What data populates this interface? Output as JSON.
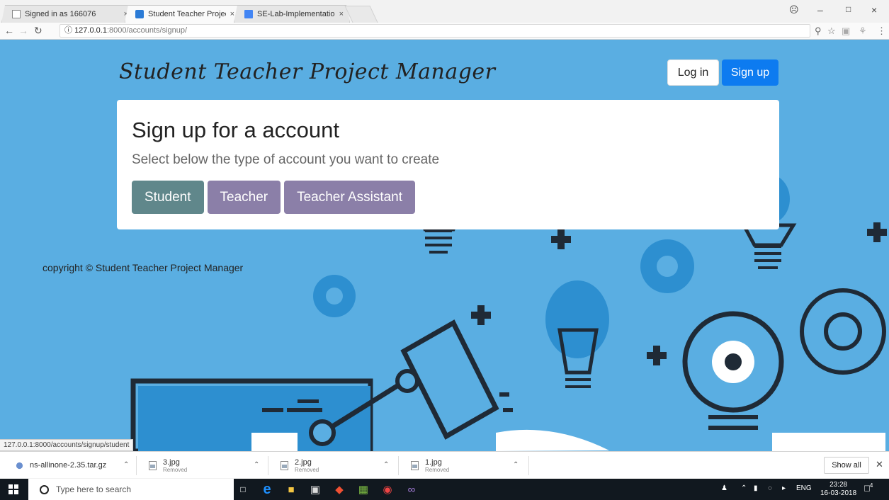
{
  "browser": {
    "tabs": [
      {
        "label": "Signed in as 166076",
        "close": "×"
      },
      {
        "label": "Student Teacher Project I",
        "close": "×"
      },
      {
        "label": "SE-Lab-Implementation-",
        "close": "×"
      }
    ],
    "address": {
      "host": "127.0.0.1",
      "path": ":8000/accounts/signup/"
    },
    "status_url": "127.0.0.1:8000/accounts/signup/student"
  },
  "page": {
    "brand": "Student Teacher Project Manager",
    "nav": {
      "login": "Log in",
      "signup": "Sign up"
    },
    "card": {
      "title": "Sign up for a account",
      "subtitle": "Select below the type of account you want to create",
      "choices": {
        "student": "Student",
        "teacher": "Teacher",
        "ta": "Teacher Assistant"
      }
    },
    "copyright": "copyright © Student Teacher Project Manager"
  },
  "downloads": {
    "items": [
      {
        "name": "ns-allinone-2.35.tar.gz",
        "sub": ""
      },
      {
        "name": "3.jpg",
        "sub": "Removed"
      },
      {
        "name": "2.jpg",
        "sub": "Removed"
      },
      {
        "name": "1.jpg",
        "sub": "Removed"
      }
    ],
    "show_all": "Show all"
  },
  "taskbar": {
    "search_placeholder": "Type here to search",
    "lang": "ENG",
    "time": "23:28",
    "date": "16-03-2018",
    "notifications": "4"
  },
  "colors": {
    "background": "#5aaee2",
    "primary": "#0d7bf0",
    "student": "#60878b",
    "teacher": "#8b7fa8"
  }
}
